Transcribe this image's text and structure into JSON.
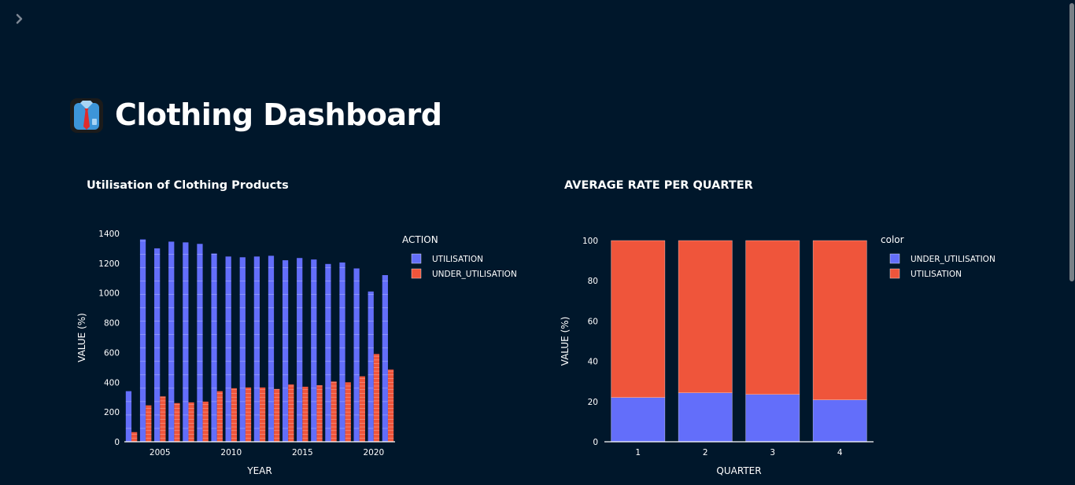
{
  "page": {
    "title": "Clothing Dashboard",
    "title_icon": "necktie-shirt-icon",
    "sidebar_toggle_icon": "chevron-right-icon"
  },
  "colors": {
    "background": "#00172b",
    "series_blue": "#636efa",
    "series_red": "#ef553b"
  },
  "chart_data": [
    {
      "type": "bar",
      "title": "Utilisation of Clothing Products",
      "xlabel": "YEAR",
      "ylabel": "VALUE (%)",
      "legend_title": "ACTION",
      "legend_position": "top-right",
      "barmode": "group",
      "x": [
        2003,
        2004,
        2005,
        2006,
        2007,
        2008,
        2009,
        2010,
        2011,
        2012,
        2013,
        2014,
        2015,
        2016,
        2017,
        2018,
        2019,
        2020,
        2021
      ],
      "xticks": [
        2005,
        2010,
        2015,
        2020
      ],
      "ylim": [
        0,
        1400
      ],
      "yticks": [
        0,
        200,
        400,
        600,
        800,
        1000,
        1200,
        1400
      ],
      "series": [
        {
          "name": "UTILISATION",
          "color": "#636efa",
          "values": [
            340,
            1360,
            1300,
            1345,
            1340,
            1330,
            1265,
            1245,
            1240,
            1245,
            1250,
            1220,
            1235,
            1225,
            1195,
            1205,
            1165,
            1010,
            1120
          ]
        },
        {
          "name": "UNDER_UTILISATION",
          "color": "#ef553b",
          "values": [
            65,
            245,
            305,
            260,
            265,
            270,
            340,
            360,
            365,
            365,
            355,
            385,
            370,
            380,
            405,
            400,
            440,
            590,
            485
          ]
        }
      ]
    },
    {
      "type": "bar",
      "title": "AVERAGE RATE PER QUARTER",
      "xlabel": "QUARTER",
      "ylabel": "VALUE (%)",
      "legend_title": "color",
      "legend_position": "top-right",
      "barmode": "stack",
      "categories": [
        "1",
        "2",
        "3",
        "4"
      ],
      "ylim": [
        0,
        100
      ],
      "yticks": [
        0,
        20,
        40,
        60,
        80,
        100
      ],
      "series": [
        {
          "name": "UNDER_UTILISATION",
          "color": "#636efa",
          "values": [
            22,
            24.3,
            23.5,
            20.8
          ]
        },
        {
          "name": "UTILISATION",
          "color": "#ef553b",
          "values": [
            78,
            75.7,
            76.5,
            79.2
          ]
        }
      ]
    }
  ]
}
